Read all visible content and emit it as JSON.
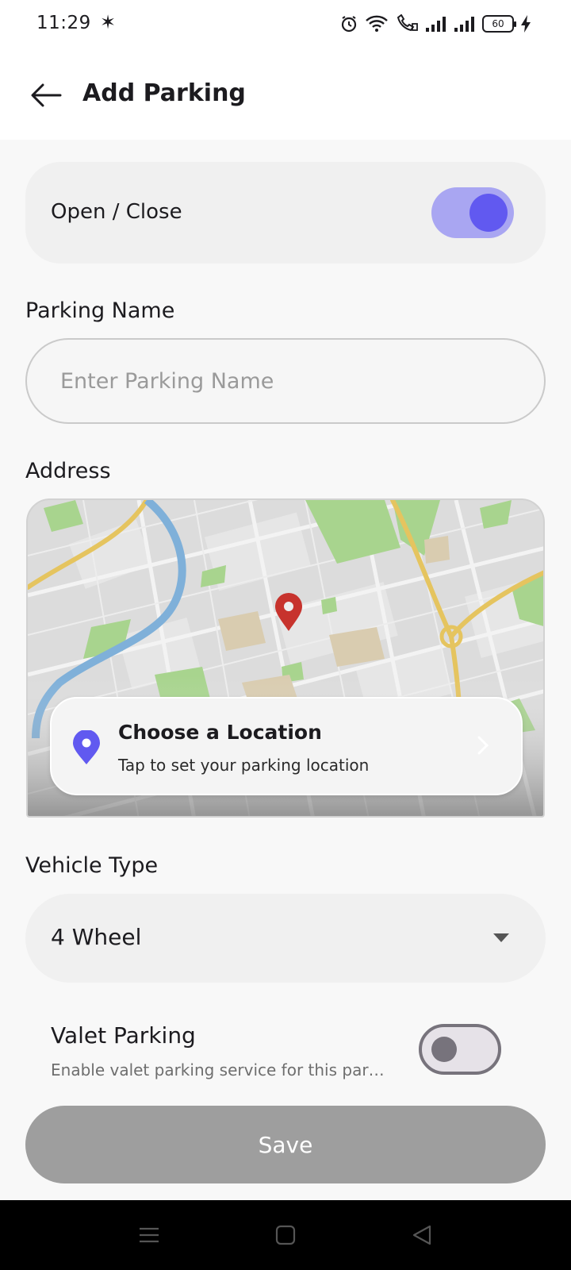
{
  "status_bar": {
    "time": "11:29",
    "battery_level": "60"
  },
  "header": {
    "title": "Add Parking",
    "back_icon": "arrow-left-icon"
  },
  "open_close": {
    "label": "Open / Close",
    "enabled": true
  },
  "parking_name": {
    "label": "Parking Name",
    "value": "",
    "placeholder": "Enter Parking Name"
  },
  "address": {
    "label": "Address",
    "card_title": "Choose a Location",
    "card_subtitle": "Tap to set your parking location"
  },
  "vehicle_type": {
    "label": "Vehicle Type",
    "selected": "4 Wheel"
  },
  "valet": {
    "title": "Valet Parking",
    "description": "Enable valet parking service for this parking",
    "enabled": false
  },
  "save_label": "Save",
  "colors": {
    "accent": "#6159f0",
    "accent_light": "#a9a6f2",
    "pin_red": "#c7332d",
    "save_disabled": "#9e9e9e"
  }
}
